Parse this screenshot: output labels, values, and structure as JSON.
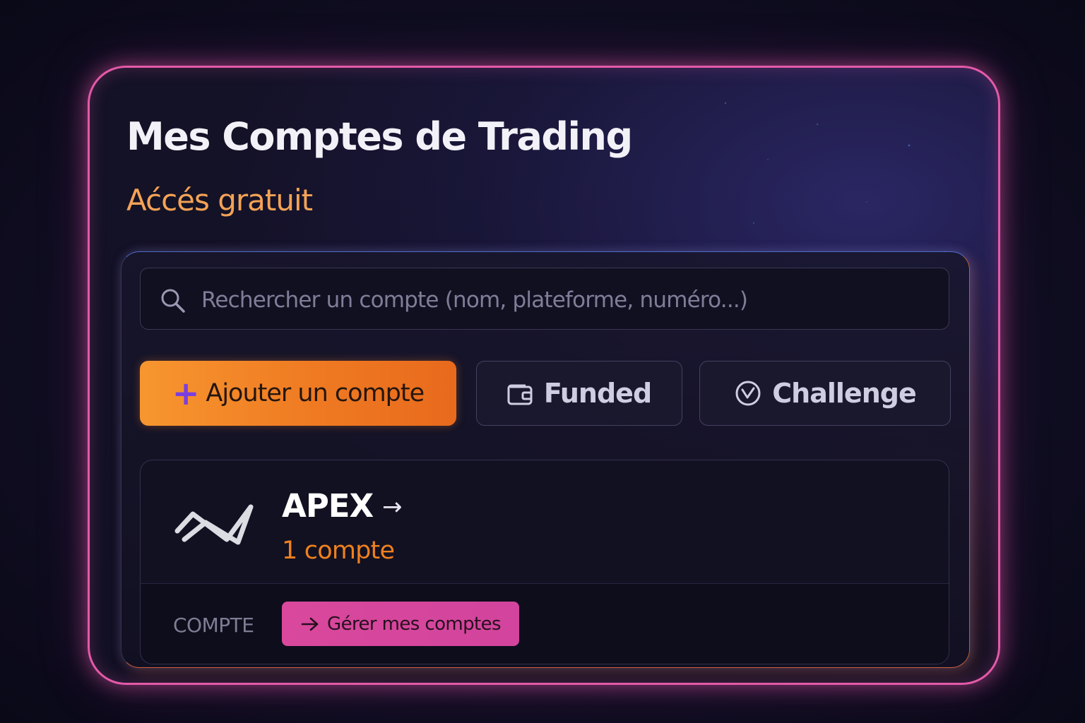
{
  "header": {
    "title": "Mes Comptes de Trading",
    "subtitle": "Aćcés gratuit"
  },
  "search": {
    "placeholder": "Rechercher un compte (nom, plateforme, numéro...)",
    "icon": "search-icon"
  },
  "actions": {
    "add_label": "Ajouter un compte",
    "add_icon": "plus-icon",
    "funded_label": "Funded",
    "funded_icon": "wallet-icon",
    "challenge_label": "Challenge",
    "challenge_icon": "check-circle-icon"
  },
  "accounts": [
    {
      "name": "APEX",
      "arrow": "→",
      "count": "1 compte",
      "footer_label": "COMPTE",
      "manage_label": "Gérer mes comptes",
      "manage_icon": "arrow-right-icon"
    }
  ],
  "colors": {
    "frame_border": "#e45aa8",
    "subtitle": "#f4a356",
    "add_button": "#f7962f",
    "plus_icon": "#7b3fe0",
    "count_text": "#f0801e",
    "manage_button": "#d9489c"
  }
}
